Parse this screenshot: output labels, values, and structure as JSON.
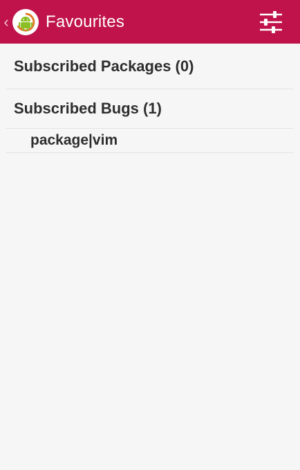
{
  "header": {
    "title": "Favourites",
    "background_color": "#c0134c",
    "up_icon": "chevron-left-icon",
    "logo_icon": "android-logo-icon",
    "settings_icon": "sliders-icon"
  },
  "favourites": {
    "groups": [
      {
        "label": "Subscribed Packages (0)",
        "items": []
      },
      {
        "label": "Subscribed Bugs (1)",
        "items": [
          {
            "label": "package|vim"
          }
        ]
      }
    ]
  }
}
